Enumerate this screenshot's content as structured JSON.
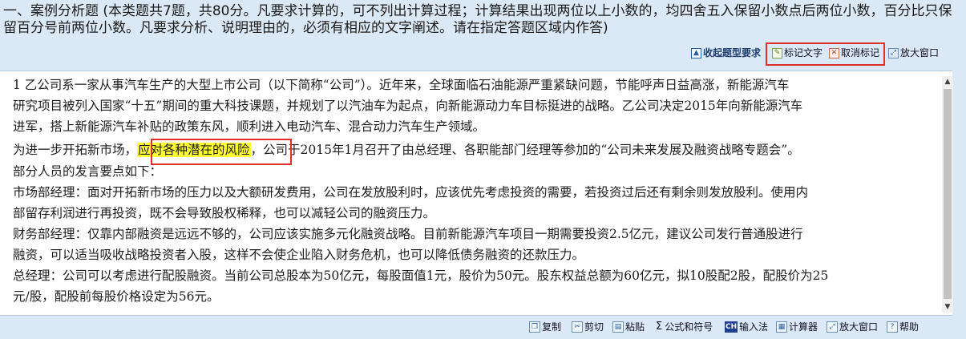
{
  "header": {
    "instructions": "一、案例分析题 (本类题共7题，共80分。凡要求计算的，可不列出计算过程；计算结果出现两位以上小数的，均四舍五入保留小数点后两位小数，百分比只保留百分号前两位小数。凡要求分析、说明理由的，必须有相应的文字阐述。请在指定答题区域内作答)"
  },
  "toolbar_top": {
    "collapse_label": "收起题型要求",
    "mark_label": "标记文字",
    "unmark_label": "取消标记",
    "zoom_label": "放大窗口"
  },
  "content": {
    "lines": [
      "1 乙公司系一家从事汽车生产的大型上市公司（以下简称“公司”）。近年来，全球面临石油能源严重紧缺问题，节能呼声日益高涨，新能源汽车",
      "研究项目被列入国家“十五”期间的重大科技课题，并规划了以汽油车为起点，向新能源动力车目标挺进的战略。乙公司决定2015年向新能源汽车",
      "进军，搭上新能源汽车补贴的政策东风，顺利进入电动汽车、混合动力汽车生产领域。",
      "部分人员的发言要点如下：",
      "市场部经理：面对开拓新市场的压力以及大额研发费用，公司在发放股利时，应该优先考虑投资的需要，若投资过后还有剩余则发放股利。使用内",
      "部留存利润进行再投资，既不会导致股权稀释，也可以减轻公司的融资压力。",
      "财务部经理：仅靠内部融资是远远不够的，公司应该实施多元化融资战略。目前新能源汽车项目一期需要投资2.5亿元，建议公司发行普通股进行",
      "融资，可以适当吸收战略投资者入股，这样不会使企业陷入财务危机，也可以降低债务融资的还款压力。",
      "总经理：公司可以考虑进行配股融资。当前公司总股本为50亿元，每股面值1元，股价为50元。股东权益总额为60亿元，拟10股配2股，配股价为25",
      "元/股，配股前每股价格设定为56元。"
    ],
    "line4_prefix": "为进一步开拓新市场，",
    "line4_highlight": "应对各种潜在的风险",
    "line4_suffix": "，公司于2015年1月召开了由总经理、各职能部门经理等参加的“公司未来发展及融资战略专题会”。"
  },
  "toolbar_bottom": {
    "copy_label": "复制",
    "cut_label": "剪切",
    "paste_label": "粘贴",
    "formula_label": "公式和符号",
    "ime_label": "输入法",
    "ime_icon_text": "CH",
    "calc_label": "计算器",
    "zoom_label": "放大窗口",
    "help_label": "帮助"
  },
  "colors": {
    "background": "#dbe9f7",
    "highlight": "#ffff33",
    "annotation_box": "#e0302a"
  }
}
